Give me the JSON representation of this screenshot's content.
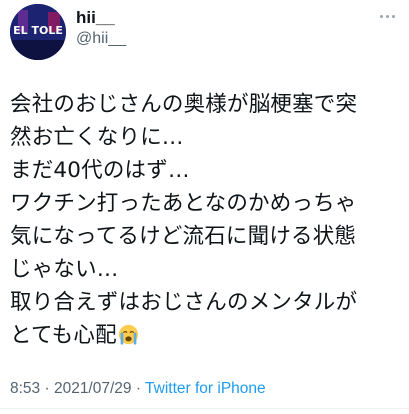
{
  "tweet": {
    "display_name": "hii__",
    "handle": "@hii__",
    "avatar_text": "EL TOLE",
    "text_lines": [
      "会社のおじさんの奥様が脳梗塞で突",
      "然お亡くなりに…",
      "まだ40代のはず…",
      "ワクチン打ったあとなのかめっちゃ",
      "気になってるけど流石に聞ける状態",
      "じゃない…",
      "取り合えずはおじさんのメンタルが",
      "とても心配"
    ],
    "emoji": "crying-face-emoji",
    "time": "8:53",
    "separator_1": " · ",
    "date": "2021/07/29",
    "separator_2": " · ",
    "source": "Twitter for iPhone"
  },
  "colors": {
    "text": "#0f1419",
    "secondary": "#536471",
    "link": "#1d9bf0",
    "avatar": "#1a237e"
  }
}
